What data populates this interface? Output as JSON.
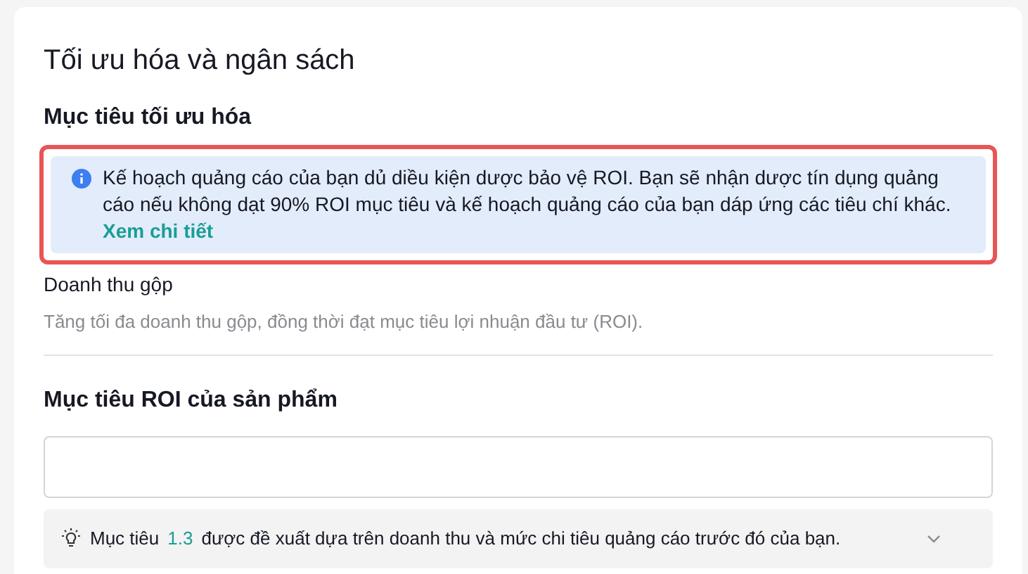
{
  "section_title": "Tối ưu hóa và ngân sách",
  "goal": {
    "heading": "Mục tiêu tối ưu hóa",
    "notice": {
      "text": "Kế hoạch quảng cáo của bạn dủ diều kiện dược bảo vệ ROI. Bạn sẽ nhận dược tín dụng quảng cáo nếu không dạt 90% ROI mục tiêu và kế hoạch quảng cáo của bạn dáp ứng các tiêu chí khác.",
      "link": "Xem chi tiết",
      "highlighted": true
    },
    "option_title": "Doanh thu gộp",
    "option_description": "Tăng tối đa doanh thu gộp, đồng thời đạt mục tiêu lợi nhuận đầu tư (ROI)."
  },
  "roi": {
    "heading": "Mục tiêu ROI của sản phẩm",
    "suggestion": {
      "prefix": "Mục tiêu",
      "value": "1.3",
      "suffix": "được đề xuất dựa trên doanh thu và mức chi tiêu quảng cáo trước đó của bạn.",
      "expanded": false
    }
  }
}
